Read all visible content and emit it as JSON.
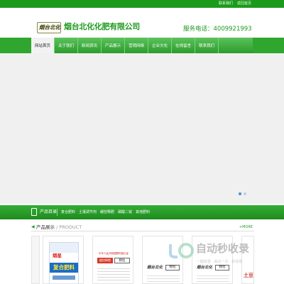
{
  "topbar": {
    "links": [
      "联系我们",
      "返回首页"
    ]
  },
  "header": {
    "logo_text": "烟台北化",
    "company_name": "烟台北化化肥有限公司",
    "service_phone": "服务电话：4009921993"
  },
  "nav": {
    "items": [
      {
        "label": "网站首页",
        "active": true
      },
      {
        "label": "关于我们",
        "active": false
      },
      {
        "label": "新闻资讯",
        "active": false
      },
      {
        "label": "产品展示",
        "active": false
      },
      {
        "label": "营销网络",
        "active": false
      },
      {
        "label": "企业文化",
        "active": false
      },
      {
        "label": "在线留言",
        "active": false
      },
      {
        "label": "联系我们",
        "active": false
      }
    ]
  },
  "banner": {
    "dots": 2,
    "active_dot": 1
  },
  "categories": {
    "title": "产品目录",
    "items": [
      "复合肥料",
      "土壤调节剂",
      "缓控释肥",
      "磷酸二铵",
      "其他肥料"
    ]
  },
  "products": {
    "title": "产品展示",
    "subtitle": "/ PRODUCT",
    "more_label": "+MORE",
    "cards": [
      {
        "brand": "烟星",
        "name": "复合肥料"
      },
      {
        "label_head": "中华人民共和国肥料登记证",
        "badge": "缓控释肥",
        "box": "颗粒"
      },
      {
        "logo": "烟台北化",
        "box": "颗粒"
      },
      {
        "logo": "烟台北化",
        "box": "颗粒"
      },
      {
        "partial_text": "土豆花生肥"
      }
    ]
  },
  "watermark": {
    "text": "自动秒收录",
    "sub": "一键收录 · 来访一次 · 秒收录"
  },
  "colors": {
    "brand_green": "#1e9a1e",
    "nav_green": "#2fa72f",
    "accent_blue": "#4a90c8"
  }
}
